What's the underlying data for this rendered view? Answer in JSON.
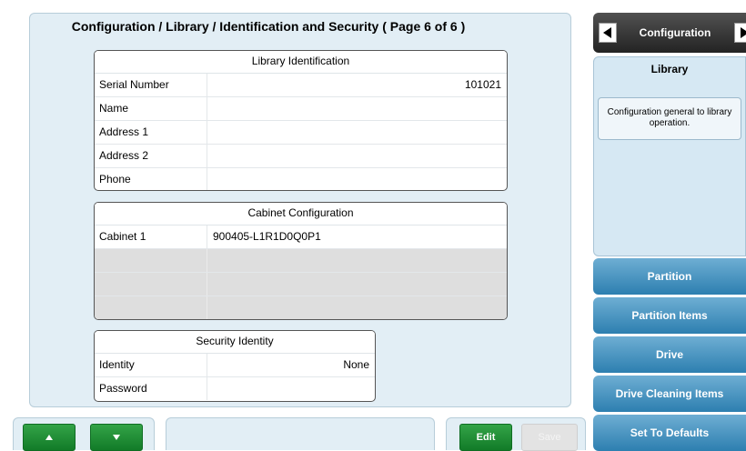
{
  "page_title": "Configuration / Library / Identification and Security ( Page 6 of 6 )",
  "library_identification": {
    "title": "Library Identification",
    "rows": [
      {
        "label": "Serial Number",
        "value": "101021"
      },
      {
        "label": "Name",
        "value": ""
      },
      {
        "label": "Address 1",
        "value": ""
      },
      {
        "label": "Address 2",
        "value": ""
      },
      {
        "label": "Phone",
        "value": ""
      }
    ]
  },
  "cabinet_configuration": {
    "title": "Cabinet Configuration",
    "rows": [
      {
        "label": "Cabinet 1",
        "value": "900405-L1R1D0Q0P1"
      }
    ]
  },
  "security_identity": {
    "title": "Security Identity",
    "rows": [
      {
        "label": "Identity",
        "value": "None"
      },
      {
        "label": "Password",
        "value": ""
      }
    ]
  },
  "sidebar": {
    "nav_title": "Configuration",
    "heading": "Library",
    "description": "Configuration general to library operation.",
    "buttons": [
      "Partition",
      "Partition Items",
      "Drive",
      "Drive Cleaning Items",
      "Set To Defaults"
    ]
  },
  "bottom": {
    "up_icon": "up-arrow-icon",
    "down_icon": "down-arrow-icon",
    "edit_label": "Edit",
    "save_label": "Save"
  },
  "colors": {
    "panel_bg": "#e2eef5",
    "sidebar_button": "#2d7fb0",
    "green_button": "#127b28",
    "nav_dark": "#232323"
  }
}
